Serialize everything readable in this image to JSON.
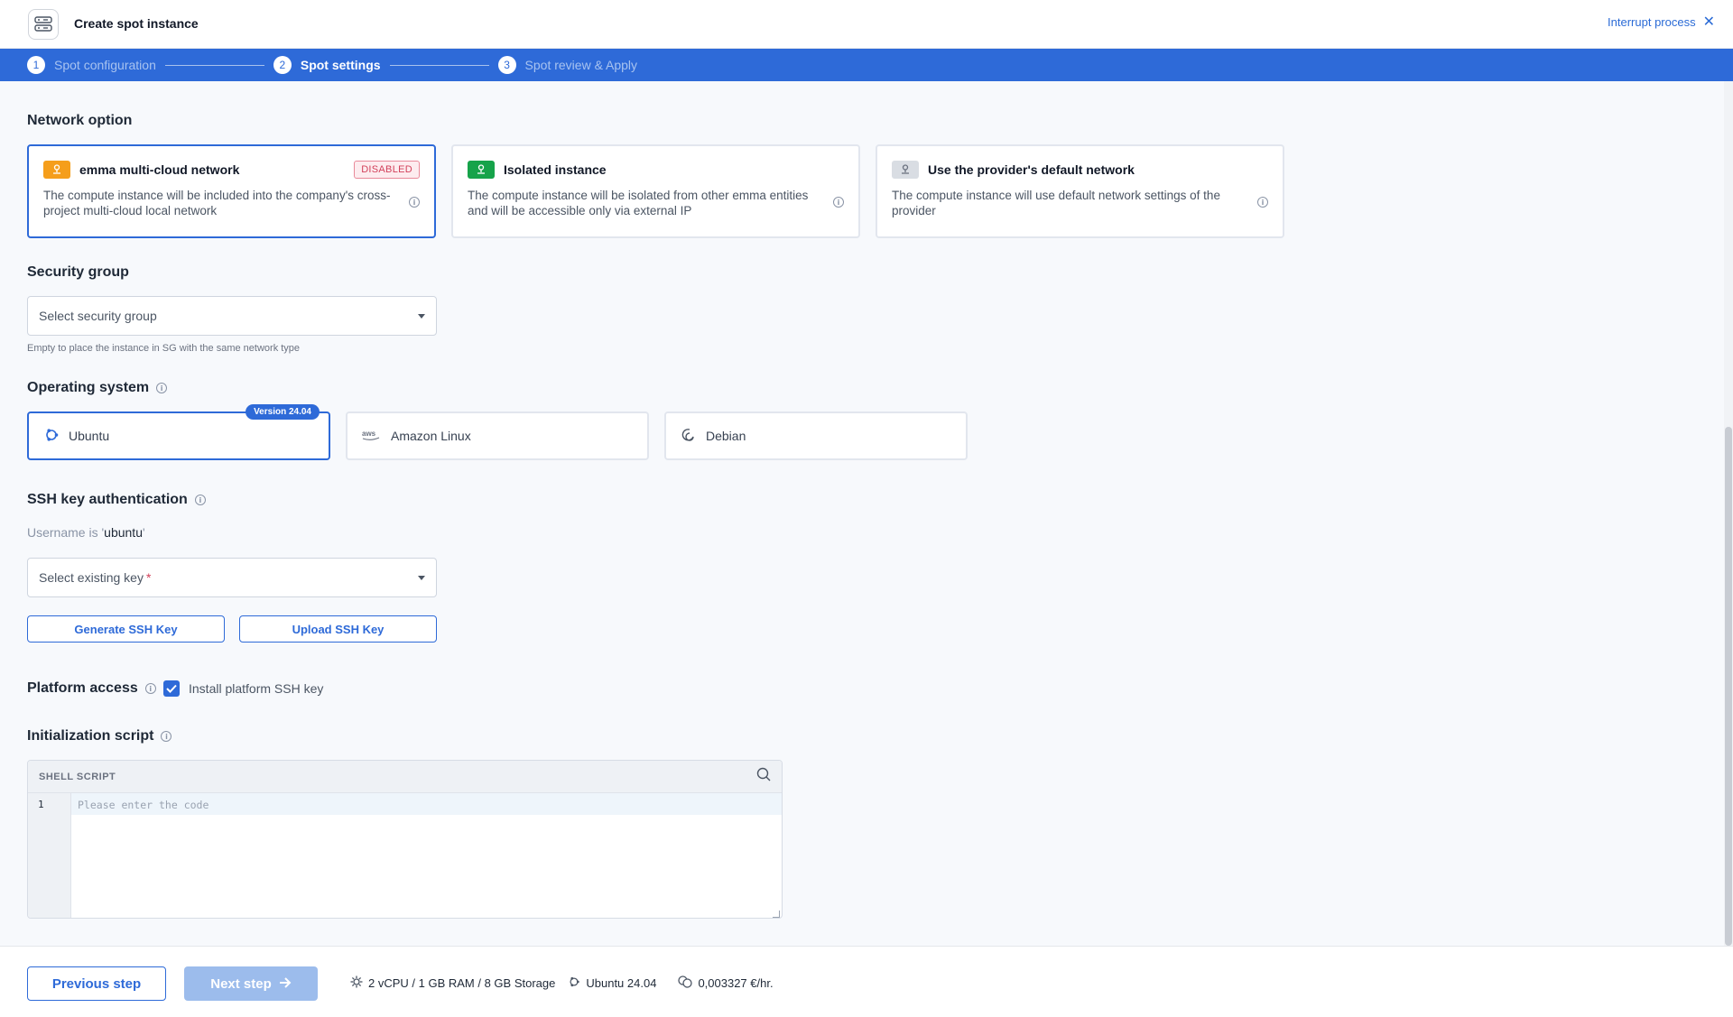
{
  "header": {
    "title": "Create spot instance",
    "interrupt_label": "Interrupt process"
  },
  "stepper": {
    "steps": [
      {
        "num": "1",
        "label": "Spot configuration"
      },
      {
        "num": "2",
        "label": "Spot settings"
      },
      {
        "num": "3",
        "label": "Spot review & Apply"
      }
    ]
  },
  "network": {
    "title": "Network option",
    "options": [
      {
        "name": "emma multi-cloud network",
        "desc": "The compute instance will be included into the company's cross-project multi-cloud local network",
        "tag": "DISABLED",
        "badge_color": "#f59e1b"
      },
      {
        "name": "Isolated instance",
        "desc": "The compute instance will be isolated from other emma entities and will be accessible only via external IP",
        "badge_color": "#16a34a"
      },
      {
        "name": "Use the provider's default network",
        "desc": "The compute instance will use default network settings of the provider",
        "badge_color": "#d1d5db"
      }
    ]
  },
  "security_group": {
    "title": "Security group",
    "placeholder": "Select security group",
    "helper": "Empty to place the instance in SG with the same network type"
  },
  "os": {
    "title": "Operating system",
    "options": [
      {
        "name": "Ubuntu",
        "tag": "Version 24.04"
      },
      {
        "name": "Amazon Linux"
      },
      {
        "name": "Debian"
      }
    ]
  },
  "ssh": {
    "title": "SSH key authentication",
    "username_prefix": "Username is '",
    "username": "ubuntu",
    "username_suffix": "'",
    "select_placeholder": "Select existing key",
    "required_mark": "*",
    "generate_label": "Generate SSH Key",
    "upload_label": "Upload SSH Key"
  },
  "platform": {
    "title": "Platform access",
    "checkbox_label": "Install platform SSH key"
  },
  "init_script": {
    "title": "Initialization script",
    "language": "SHELL SCRIPT",
    "line_number": "1",
    "placeholder": "Please enter the code"
  },
  "footer": {
    "prev_label": "Previous step",
    "next_label": "Next step",
    "spec": "2 vCPU / 1 GB RAM / 8 GB Storage",
    "os": "Ubuntu 24.04",
    "price": "0,003327 €/hr."
  },
  "colors": {
    "accent": "#2e6ad8",
    "disabled_tag": "#d2405a"
  }
}
